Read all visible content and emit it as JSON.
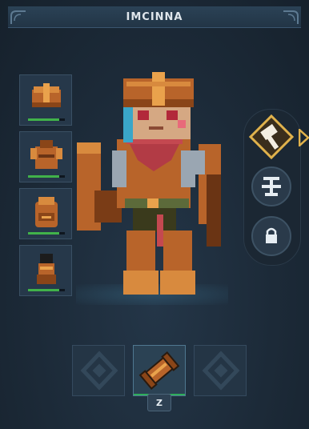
{
  "panel": {
    "title": "IMCINNA"
  },
  "gear_slots": [
    {
      "name": "helmet",
      "icon": "helmet-icon",
      "durability": 0.85
    },
    {
      "name": "chest",
      "icon": "chestplate-icon",
      "durability": 0.85
    },
    {
      "name": "backpack",
      "icon": "backpack-icon",
      "durability": 0.85
    },
    {
      "name": "boots",
      "icon": "boots-icon",
      "durability": 0.85
    }
  ],
  "tool_rail": {
    "buttons": [
      {
        "icon": "hammer-icon",
        "state": "selected"
      },
      {
        "icon": "emblem-icon",
        "state": "available"
      },
      {
        "icon": "lock-icon",
        "state": "locked"
      }
    ]
  },
  "abilities": {
    "slots": [
      {
        "icon": "empty-slot-emblem-icon",
        "state": "empty"
      },
      {
        "icon": "scroll-item-icon",
        "state": "equipped",
        "key": "Z"
      },
      {
        "icon": "empty-slot-emblem-icon",
        "state": "empty"
      }
    ],
    "key_label": "Z"
  },
  "colors": {
    "background": "#1a2735",
    "accent_gold": "#e0b24c",
    "durability_green": "#41b24a",
    "copper_armor": "#b8642a"
  }
}
